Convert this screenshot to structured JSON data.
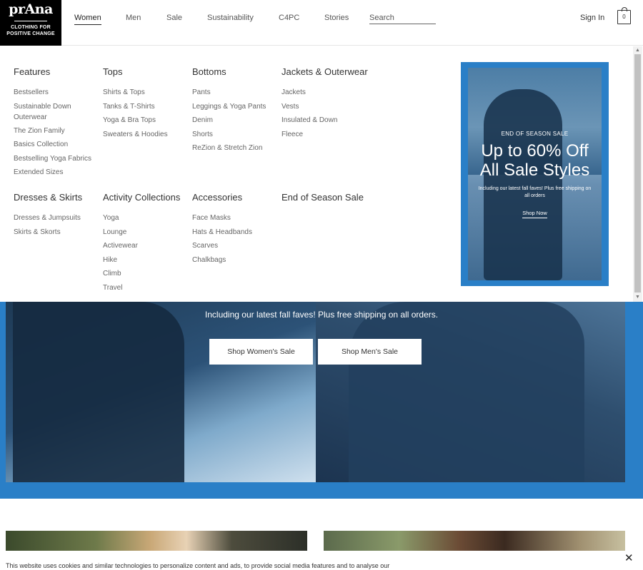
{
  "header": {
    "logo": {
      "brand": "prAna",
      "tagline_line1": "CLOTHING FOR",
      "tagline_line2": "POSITIVE CHANGE"
    },
    "nav": [
      "Women",
      "Men",
      "Sale",
      "Sustainability",
      "C4PC",
      "Stories"
    ],
    "search": {
      "placeholder": "Search",
      "value": ""
    },
    "sign_in": "Sign In",
    "bag_count": "0"
  },
  "menu": {
    "features": {
      "title": "Features",
      "items": [
        "Bestsellers",
        "Sustainable Down Outerwear",
        "The Zion Family",
        "Basics Collection",
        "Bestselling Yoga Fabrics",
        "Extended Sizes"
      ]
    },
    "tops": {
      "title": "Tops",
      "items": [
        "Shirts & Tops",
        "Tanks & T-Shirts",
        "Yoga & Bra Tops",
        "Sweaters & Hoodies"
      ]
    },
    "bottoms": {
      "title": "Bottoms",
      "items": [
        "Pants",
        "Leggings & Yoga Pants",
        "Denim",
        "Shorts",
        "ReZion & Stretch Zion"
      ]
    },
    "jackets": {
      "title": "Jackets & Outerwear",
      "items": [
        "Jackets",
        "Vests",
        "Insulated & Down",
        "Fleece"
      ]
    },
    "dresses": {
      "title": "Dresses & Skirts",
      "items": [
        "Dresses & Jumpsuits",
        "Skirts & Skorts"
      ]
    },
    "activity": {
      "title": "Activity Collections",
      "items": [
        "Yoga",
        "Lounge",
        "Activewear",
        "Hike",
        "Climb",
        "Travel"
      ]
    },
    "accessories": {
      "title": "Accessories",
      "items": [
        "Face Masks",
        "Hats & Headbands",
        "Scarves",
        "Chalkbags"
      ]
    },
    "end_of_season": {
      "title": "End of Season Sale"
    }
  },
  "promo": {
    "kicker": "END OF SEASON SALE",
    "headline_line1": "Up to 60% Off",
    "headline_line2": "All Sale Styles",
    "subtext": "Including our latest fall faves! Plus free shipping on all orders",
    "cta": "Shop Now"
  },
  "hero": {
    "subtext": "Including our latest fall faves! Plus free shipping on all orders.",
    "button_women": "Shop Women's Sale",
    "button_men": "Shop Men's Sale"
  },
  "cookie": {
    "text": "This website uses cookies and similar technologies to personalize content and ads, to provide social media features and to analyse our",
    "close": "✕"
  },
  "colors": {
    "accent_blue": "#2a7fc7",
    "logo_bg": "#000000"
  }
}
